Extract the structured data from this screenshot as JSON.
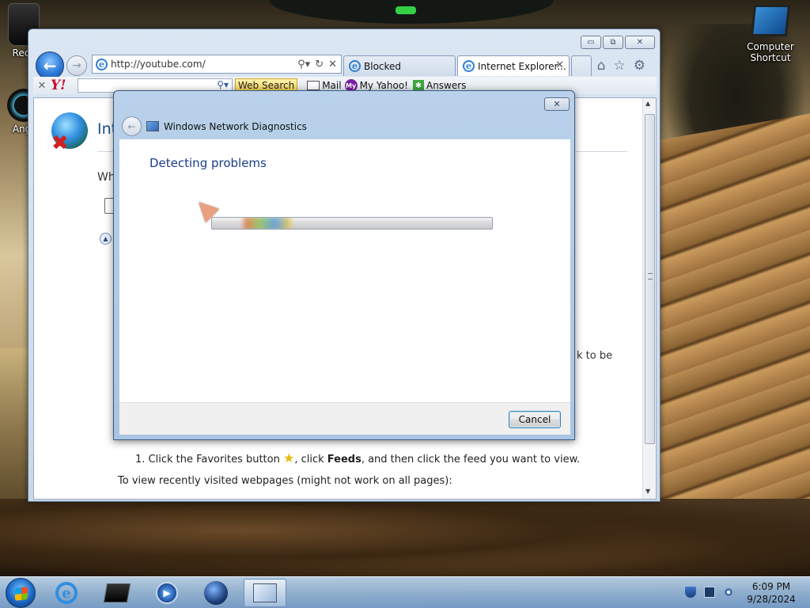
{
  "desktop": {
    "icons": {
      "recycle_bin": "Recy",
      "angry": "Angr",
      "computer_line1": "Computer",
      "computer_line2": "Shortcut"
    }
  },
  "ie": {
    "address": "http://youtube.com/",
    "tabs": [
      {
        "label": "Blocked"
      },
      {
        "label": "Internet Explorer..."
      }
    ],
    "yahoo": {
      "logo": "Y!",
      "web_search": "Web Search",
      "links": [
        "Mail",
        "My Yahoo!",
        "Answers"
      ]
    },
    "page": {
      "title": "Int",
      "what": "Wh",
      "to_be": "k to be",
      "step_prefix": "1.  Click the Favorites button",
      "step_mid": ", click ",
      "step_bold": "Feeds",
      "step_suffix": ", and then click the feed you want to view.",
      "recent": "To view recently visited webpages (might not work on all pages):"
    }
  },
  "dialog": {
    "title": "Windows Network Diagnostics",
    "heading": "Detecting problems",
    "progress_fraction": 0.0,
    "cancel": "Cancel"
  },
  "taskbar": {
    "time": "6:09 PM",
    "date": "9/28/2024"
  },
  "colors": {
    "dialog_heading": "#1b3d8c",
    "ie_title": "#1f4f8f",
    "yahoo_red": "#c8102e"
  }
}
